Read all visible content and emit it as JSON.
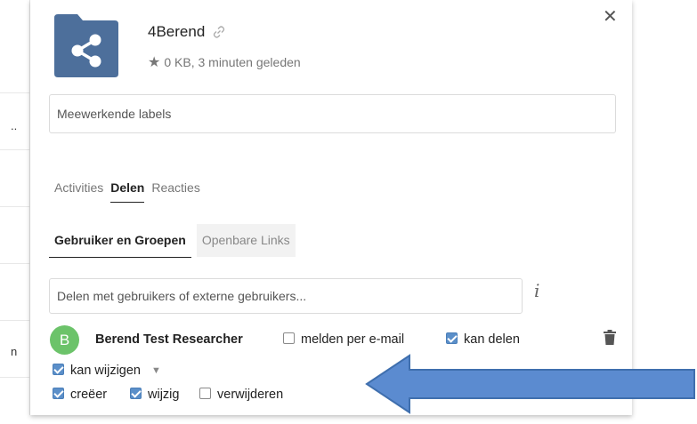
{
  "left_panel": {
    "row_texts": [
      ".."
    ],
    "bottom_text": "n"
  },
  "file": {
    "name": "4Berend",
    "meta": "0 KB, 3 minuten geleden",
    "folder_color": "#4d6f9b"
  },
  "labels_placeholder": "Meewerkende labels",
  "tabs": [
    {
      "label": "Activities"
    },
    {
      "label": "Delen"
    },
    {
      "label": "Reacties"
    }
  ],
  "subtabs": [
    {
      "label": "Gebruiker en Groepen"
    },
    {
      "label": "Openbare Links"
    }
  ],
  "share_placeholder": "Delen met gebruikers of externe gebruikers...",
  "share_entry": {
    "avatar_letter": "B",
    "name": "Berend Test Researcher",
    "options": {
      "notify_email": {
        "label": "melden per e-mail",
        "checked": false
      },
      "can_share": {
        "label": "kan delen",
        "checked": true
      },
      "can_edit": {
        "label": "kan wijzigen",
        "checked": true
      },
      "create": {
        "label": "creëer",
        "checked": true
      },
      "change": {
        "label": "wijzig",
        "checked": true
      },
      "delete": {
        "label": "verwijderen",
        "checked": false
      }
    }
  },
  "colors": {
    "accent": "#5b8fc9",
    "avatar": "#6cc36a",
    "arrow": "#5b8bd0"
  }
}
